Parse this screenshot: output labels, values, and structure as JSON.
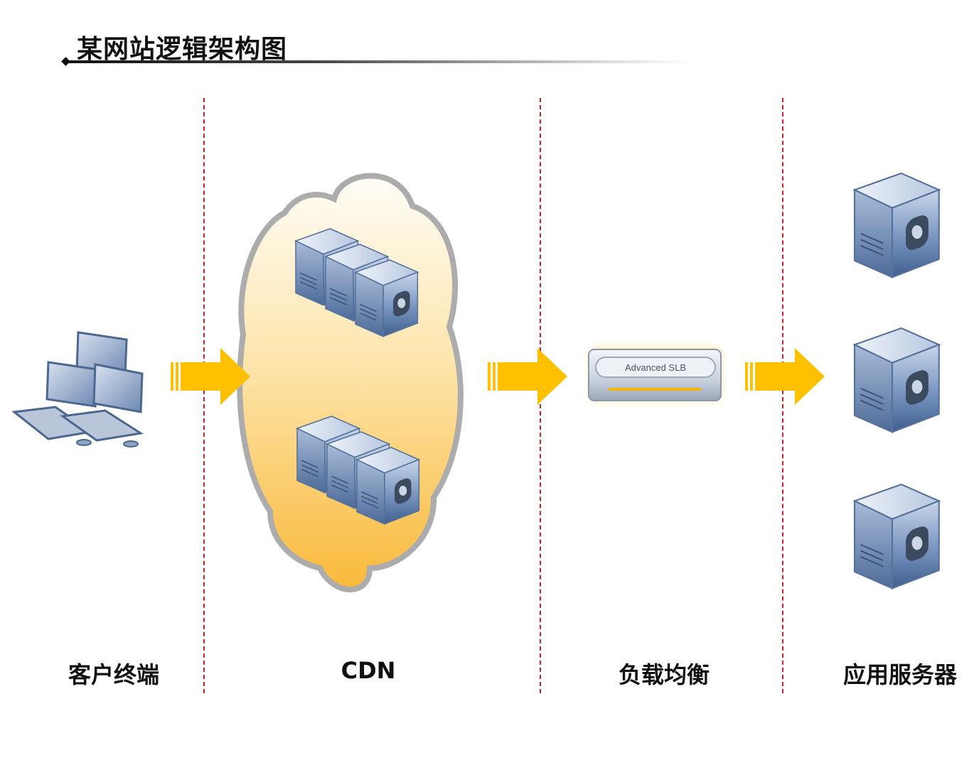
{
  "title": "某网站逻辑架构图",
  "columns": [
    {
      "label": "客户终端",
      "icon": "client-computers-icon"
    },
    {
      "label": "CDN",
      "icon": "cdn-cloud-icon"
    },
    {
      "label": "负载均衡",
      "icon": "load-balancer-icon"
    },
    {
      "label": "应用服务器",
      "icon": "server-icon"
    }
  ],
  "load_balancer": {
    "device_label": "Advanced SLB"
  },
  "colors": {
    "divider": "#d1202a",
    "arrow": "#ffbf00",
    "cloud": "#fbc964",
    "server": "#5b7aa8"
  }
}
